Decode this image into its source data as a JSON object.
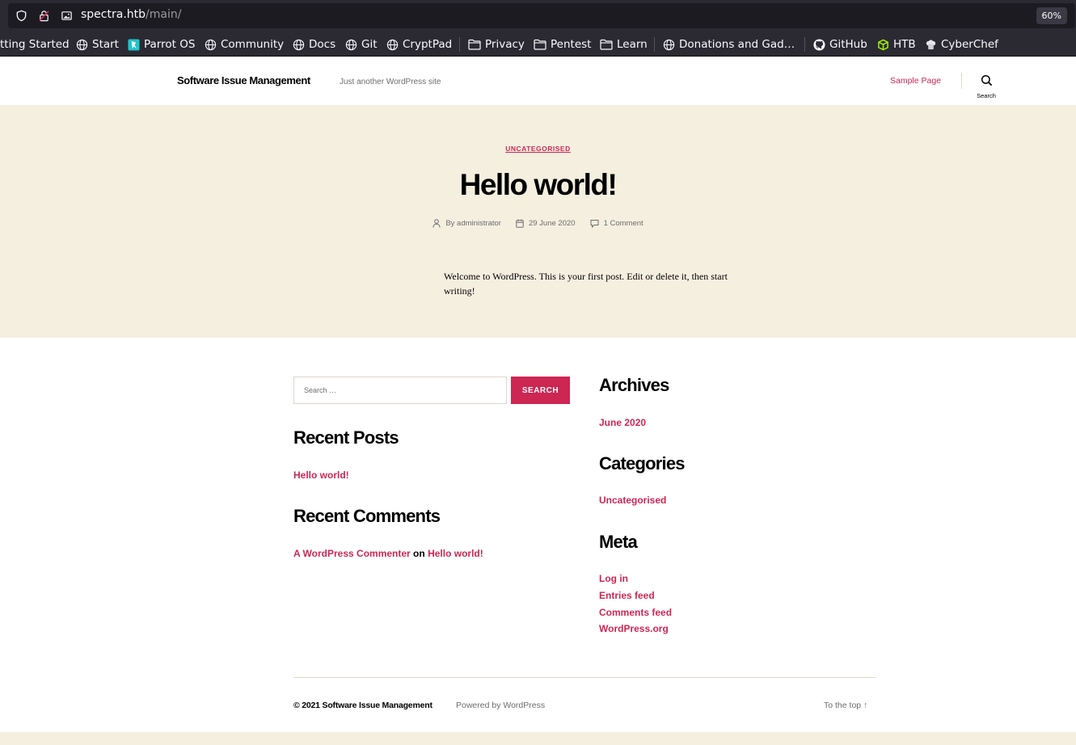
{
  "browser": {
    "url_host": "spectra.htb",
    "url_path": "/main/",
    "zoom": "60%"
  },
  "bookmarks": [
    {
      "label": "tting Started",
      "icon": "none"
    },
    {
      "label": "Start",
      "icon": "globe-icon"
    },
    {
      "label": "Parrot OS",
      "icon": "parrot-icon"
    },
    {
      "label": "Community",
      "icon": "globe-icon"
    },
    {
      "label": "Docs",
      "icon": "globe-icon"
    },
    {
      "label": "Git",
      "icon": "globe-icon"
    },
    {
      "label": "CryptPad",
      "icon": "globe-icon"
    },
    {
      "label": "Privacy",
      "icon": "folder-icon"
    },
    {
      "label": "Pentest",
      "icon": "folder-icon"
    },
    {
      "label": "Learn",
      "icon": "folder-icon"
    },
    {
      "label": "Donations and Gad…",
      "icon": "globe-icon"
    },
    {
      "label": "GitHub",
      "icon": "github-icon"
    },
    {
      "label": "HTB",
      "icon": "htb-cube-icon"
    },
    {
      "label": "CyberChef",
      "icon": "chef-icon"
    }
  ],
  "header": {
    "site_title": "Software Issue Management",
    "site_description": "Just another WordPress site",
    "nav_sample_page": "Sample Page",
    "search_label": "Search"
  },
  "post": {
    "category": "UNCATEGORISED",
    "title": "Hello world!",
    "author": "administrator",
    "author_prefix": "By ",
    "date": "29 June 2020",
    "comments": "1 Comment",
    "body": "Welcome to WordPress. This is your first post. Edit or delete it, then start writing!"
  },
  "widgets": {
    "search_placeholder": "Search …",
    "search_button": "SEARCH",
    "recent_posts_title": "Recent Posts",
    "recent_posts": [
      "Hello world!"
    ],
    "recent_comments_title": "Recent Comments",
    "recent_comment_author": "A WordPress Commenter",
    "recent_comment_on": "on",
    "recent_comment_post": "Hello world!",
    "archives_title": "Archives",
    "archives": [
      "June 2020"
    ],
    "categories_title": "Categories",
    "categories": [
      "Uncategorised"
    ],
    "meta_title": "Meta",
    "meta_links": [
      "Log in",
      "Entries feed",
      "Comments feed",
      "WordPress.org"
    ]
  },
  "footer": {
    "copyright_year": "© 2021",
    "copyright_site": "Software Issue Management",
    "powered_by": "Powered by WordPress",
    "to_top": "To the top ↑"
  },
  "colors": {
    "accent": "#cd2653",
    "hero_bg": "#f5efe0",
    "browser_chrome": "#2b2a33"
  }
}
